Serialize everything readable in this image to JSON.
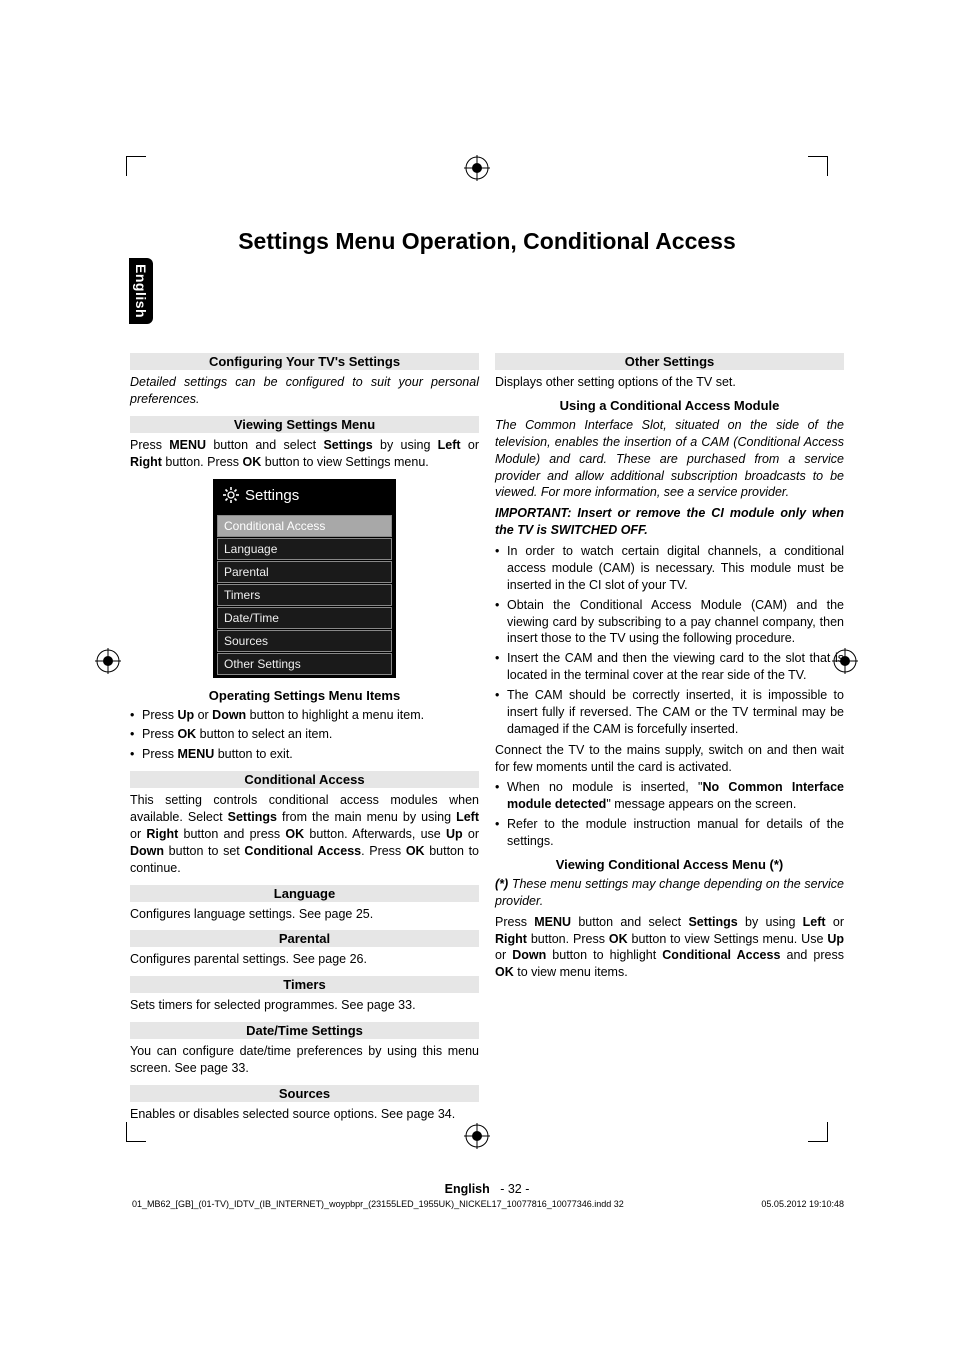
{
  "side_tab": "English",
  "main_title": "Settings Menu Operation, Conditional Access",
  "left": {
    "h_config": "Configuring Your TV's Settings",
    "p_config": "Detailed settings can be configured to suit your personal preferences.",
    "h_view": "Viewing Settings Menu",
    "view_html": "Press <b>MENU</b> button and select <b>Settings</b> by using <b>Left</b> or <b>Right</b> button. Press <b>OK</b> button to view Settings menu.",
    "menu_title": "Settings",
    "menu_items": [
      {
        "label": "Conditional Access",
        "selected": true
      },
      {
        "label": "Language",
        "selected": false
      },
      {
        "label": "Parental",
        "selected": false
      },
      {
        "label": "Timers",
        "selected": false
      },
      {
        "label": "Date/Time",
        "selected": false
      },
      {
        "label": "Sources",
        "selected": false
      },
      {
        "label": "Other Settings",
        "selected": false
      }
    ],
    "h_operating": "Operating Settings Menu Items",
    "op_b1": "Press <b>Up</b> or <b>Down</b> button to highlight a menu item.",
    "op_b2": "Press <b>OK</b> button to select an item.",
    "op_b3": "Press <b>MENU</b> button to exit.",
    "h_condacc": "Conditional Access",
    "p_condacc": "This setting controls conditional access modules when available. Select <b>Settings</b> from the main menu by using <b>Left</b> or <b>Right</b> button and press <b>OK</b> button. Afterwards, use <b>Up</b> or <b>Down</b> button to set <b>Conditional Access</b>. Press <b>OK</b> button to continue.",
    "h_lang": "Language",
    "p_lang": "Configures language settings. See page 25.",
    "h_parent": "Parental",
    "p_parent": "Configures parental settings. See page 26.",
    "h_timers": "Timers",
    "p_timers": "Sets timers for selected programmes. See page 33.",
    "h_datetime": "Date/Time Settings",
    "p_datetime": "You can configure date/time preferences by using this menu screen. See page 33.",
    "h_sources": "Sources",
    "p_sources": "Enables or disables selected source options. See page 34."
  },
  "right": {
    "h_other": "Other Settings",
    "p_other": "Displays other setting options of the TV set.",
    "h_cam": "Using a Conditional Access Module",
    "p_cam_it": "The Common Interface Slot, situated on the side of the television, enables the insertion of a CAM (Conditional Access Module) and card. These are purchased from a service provider and allow additional subscription broadcasts to be viewed. For more information, see a service provider.",
    "p_important": "IMPORTANT: Insert or remove the CI module only when the TV is SWITCHED OFF.",
    "b1": "In order to watch certain digital channels, a conditional access module (CAM) is necessary. This module must be inserted in the CI slot of your TV.",
    "b2": "Obtain the Conditional Access Module (CAM) and the viewing card by subscribing to a pay channel company, then insert those to the TV using the following procedure.",
    "b3": "Insert the CAM and then the viewing card to the slot that is located in the terminal cover at the rear side of the TV.",
    "b4": "The CAM should be correctly inserted, it is impossible to insert fully if reversed. The CAM or the TV terminal may be damaged if the CAM is forcefully inserted.",
    "p_connect": "Connect the TV to the mains supply, switch on and then wait for few moments until the card is activated.",
    "b5": "When no module is inserted, \"<b>No Common Interface module detected</b>\" message appears on the screen.",
    "b6": "Refer to the module instruction manual for details of the settings.",
    "h_viewca": "Viewing Conditional Access Menu (*)",
    "p_note": "(*) These menu settings may change depending on the service provider.",
    "p_viewca": "Press <b>MENU</b> button and select <b>Settings</b> by using <b>Left</b> or <b>Right</b> button. Press <b>OK</b> button to view Settings menu. Use <b>Up</b> or <b>Down</b> button to highlight <b>Conditional Access</b> and press <b>OK</b> to view menu items."
  },
  "footer": {
    "lang": "English",
    "page": "- 32 -"
  },
  "indd": {
    "file": "01_MB62_[GB]_(01-TV)_IDTV_(IB_INTERNET)_woypbpr_(23155LED_1955UK)_NICKEL17_10077816_10077346.indd   32",
    "ts": "05.05.2012   19:10:48"
  }
}
